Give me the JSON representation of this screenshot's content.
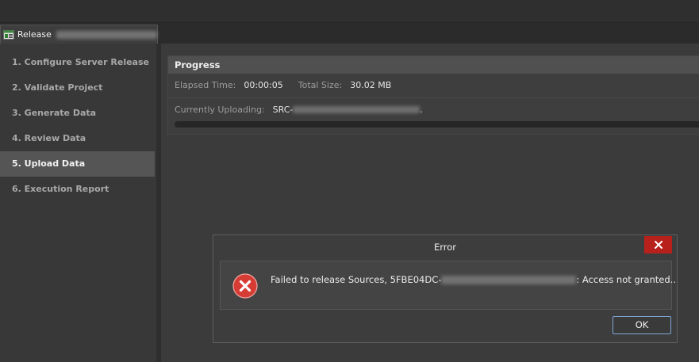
{
  "tab": {
    "label": "Release",
    "icon": "release-document-icon"
  },
  "sidebar": {
    "steps": [
      {
        "label": "1. Configure Server Release"
      },
      {
        "label": "2. Validate Project"
      },
      {
        "label": "3. Generate Data"
      },
      {
        "label": "4. Review Data"
      },
      {
        "label": "5. Upload Data"
      },
      {
        "label": "6. Execution Report"
      }
    ],
    "active_index": 4
  },
  "progress": {
    "title": "Progress",
    "elapsed_label": "Elapsed Time:",
    "elapsed_value": "00:00:05",
    "size_label": "Total Size:",
    "size_value": "30.02 MB",
    "uploading_label": "Currently Uploading:",
    "uploading_value_prefix": "SRC-",
    "uploading_value_suffix": ".",
    "bar_fraction": 0
  },
  "dialog": {
    "title": "Error",
    "message_prefix": "Failed to release Sources, 5FBE04DC-",
    "message_suffix": ": Access not granted..",
    "ok_label": "OK",
    "close_icon": "close-icon",
    "error_icon": "error-icon",
    "error_color": "#d63b34",
    "close_color": "#b8211b"
  }
}
